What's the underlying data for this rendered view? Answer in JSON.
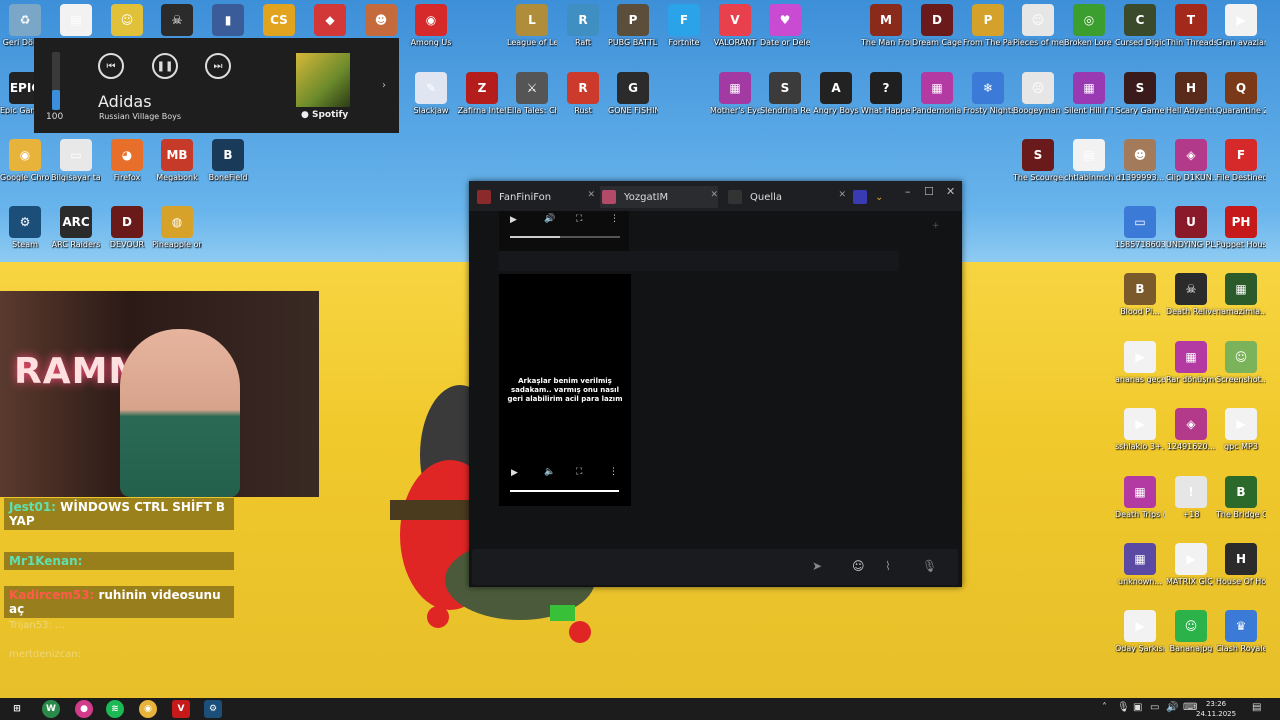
{
  "desktop": {
    "icons_top": [
      {
        "label": "Geri Dönüş",
        "glyph": "♻",
        "color": "#7aa7c7"
      },
      {
        "label": "",
        "glyph": "▤",
        "color": "#f2f2f2"
      },
      {
        "label": "",
        "glyph": "☺",
        "color": "#e2c13a"
      },
      {
        "label": "",
        "glyph": "☠",
        "color": "#2b2b2b"
      },
      {
        "label": "",
        "glyph": "▮",
        "color": "#3a5d9a"
      },
      {
        "label": "",
        "glyph": "CS",
        "color": "#e2a31f"
      },
      {
        "label": "",
        "glyph": "◆",
        "color": "#d23838"
      },
      {
        "label": "",
        "glyph": "☻",
        "color": "#c46a3c"
      },
      {
        "label": "Among Us",
        "glyph": "◉",
        "color": "#d62a2a"
      },
      {
        "label": "League of Legends",
        "glyph": "L",
        "color": "#b08d3a"
      },
      {
        "label": "Raft",
        "glyph": "R",
        "color": "#3f8fc3"
      },
      {
        "label": "PUBG BATTLEGR...",
        "glyph": "P",
        "color": "#5b4e3a"
      },
      {
        "label": "Fortnite",
        "glyph": "F",
        "color": "#2aa3e8"
      },
      {
        "label": "VALORANT",
        "glyph": "V",
        "color": "#e8404d"
      },
      {
        "label": "Date or Delete Ki...",
        "glyph": "♥",
        "color": "#c84bd1"
      },
      {
        "label": "The Man From Jonah",
        "glyph": "M",
        "color": "#8a2a1a"
      },
      {
        "label": "Dream Cage",
        "glyph": "D",
        "color": "#6a1a1a"
      },
      {
        "label": "From The Past",
        "glyph": "P",
        "color": "#d4a22a"
      },
      {
        "label": "Pieces of me",
        "glyph": "☺",
        "color": "#e6e6e6"
      },
      {
        "label": "Broken Lore DON'T W...",
        "glyph": "◎",
        "color": "#3c9e2f"
      },
      {
        "label": "Cursed Digicam 2...",
        "glyph": "C",
        "color": "#3b4a2a"
      },
      {
        "label": "Thin Threads",
        "glyph": "T",
        "color": "#a3291a"
      },
      {
        "label": "Gran avazlam MP3",
        "glyph": "▶",
        "color": "#f2f2f2"
      }
    ],
    "icons_row2": [
      {
        "label": "Epic Games Launcher",
        "glyph": "EPIC",
        "color": "#222"
      },
      {
        "label": "Slackjaw",
        "glyph": "✎",
        "color": "#dfe6f2"
      },
      {
        "label": "Zafirna Intel",
        "glyph": "Z",
        "color": "#b51d1d"
      },
      {
        "label": "Ella Tales: Chalkbound",
        "glyph": "⚔",
        "color": "#555"
      },
      {
        "label": "Rust",
        "glyph": "R",
        "color": "#cc3a2b"
      },
      {
        "label": "GONE FISHING",
        "glyph": "G",
        "color": "#2b2b2b"
      },
      {
        "label": "Mother's Eye DEMO.zip",
        "glyph": "▦",
        "color": "#a33aa3"
      },
      {
        "label": "Slendrina Remake",
        "glyph": "S",
        "color": "#3b3b3b"
      },
      {
        "label": "Angry Boys",
        "glyph": "A",
        "color": "#222"
      },
      {
        "label": "What Happened...",
        "glyph": "?",
        "color": "#1f1f1f"
      },
      {
        "label": "Pandemonia No BEKM - Ep...",
        "glyph": "▦",
        "color": "#b33aa3"
      },
      {
        "label": "Frosty Nights",
        "glyph": "❄",
        "color": "#3b7ad6"
      },
      {
        "label": "Boogeyman 2",
        "glyph": "☹",
        "color": "#e6e6e6"
      },
      {
        "label": "Silent Hill f Türkçe Yam...",
        "glyph": "▦",
        "color": "#9a3ab3"
      },
      {
        "label": "Scary Game",
        "glyph": "S",
        "color": "#3a1a1a"
      },
      {
        "label": "Hell Adventure",
        "glyph": "H",
        "color": "#5a2a1a"
      },
      {
        "label": "Quarantine Zone The...",
        "glyph": "Q",
        "color": "#7a3a1a"
      }
    ],
    "icons_row3": [
      {
        "label": "Google Chrome",
        "glyph": "◉",
        "color": "#e8b33a"
      },
      {
        "label": "Bilgisayar tarafından...",
        "glyph": "▭",
        "color": "#e8e8e8"
      },
      {
        "label": "Firefox",
        "glyph": "◕",
        "color": "#e86f2a"
      },
      {
        "label": "Megabonk",
        "glyph": "MB",
        "color": "#c63a2a"
      },
      {
        "label": "BoneField",
        "glyph": "B",
        "color": "#1a3a5a"
      }
    ],
    "icons_row4": [
      {
        "label": "Steam",
        "glyph": "⚙",
        "color": "#1b4f7a"
      },
      {
        "label": "ARC Raiders",
        "glyph": "ARC",
        "color": "#2b2b2b"
      },
      {
        "label": "DEVOUR",
        "glyph": "D",
        "color": "#6b1a1a"
      },
      {
        "label": "Pineapple on pizza",
        "glyph": "◍",
        "color": "#d6a22a"
      }
    ],
    "icons_right": [
      {
        "label": "The Scourge Lo Ölengin...",
        "glyph": "S",
        "color": "#6a1a1a"
      },
      {
        "label": "chtlabinmcht",
        "glyph": "▤",
        "color": "#f2f2f2"
      },
      {
        "label": "d1399993...",
        "glyph": "☻",
        "color": "#a37a5a"
      },
      {
        "label": "Clip D1KUN...",
        "glyph": "◈",
        "color": "#b33a8a"
      },
      {
        "label": "File Destined",
        "glyph": "F",
        "color": "#d62a2a"
      },
      {
        "label": "1585718603...",
        "glyph": "▭",
        "color": "#3b7ad6"
      },
      {
        "label": "UNDYING PLANS",
        "glyph": "U",
        "color": "#8a1a2a"
      },
      {
        "label": "Puppet House",
        "glyph": "PH",
        "color": "#c61a1a"
      },
      {
        "label": "Blood Pi...",
        "glyph": "B",
        "color": "#7a5a2a"
      },
      {
        "label": "Death Relives",
        "glyph": "☠",
        "color": "#2b2b2b"
      },
      {
        "label": "namazimla...",
        "glyph": "▦",
        "color": "#2b5a2b"
      },
      {
        "label": "ananas geçen 1...",
        "glyph": "▶",
        "color": "#f2f2f2"
      },
      {
        "label": "Rar dönüşmesi",
        "glyph": "▦",
        "color": "#b33aa3"
      },
      {
        "label": "Screenshot...",
        "glyph": "☺",
        "color": "#7ab35a"
      },
      {
        "label": "sshlakio 3+...",
        "glyph": "▶",
        "color": "#f2f2f2"
      },
      {
        "label": "12491620...",
        "glyph": "◈",
        "color": "#b33a8a"
      },
      {
        "label": "gpc MP3",
        "glyph": "▶",
        "color": "#f2f2f2"
      },
      {
        "label": "Death Trips (Windows)...",
        "glyph": "▦",
        "color": "#b33aa3"
      },
      {
        "label": "+18",
        "glyph": "!",
        "color": "#e6e6e6"
      },
      {
        "label": "The Bridge Curse 2 The...",
        "glyph": "B",
        "color": "#2b6a2b"
      },
      {
        "label": "unknown...",
        "glyph": "▦",
        "color": "#5a4aa3"
      },
      {
        "label": "MATRIX GİÇ KAARMUS...",
        "glyph": "▶",
        "color": "#f2f2f2"
      },
      {
        "label": "House Of Horror On...",
        "glyph": "H",
        "color": "#2b2b2b"
      },
      {
        "label": "Oday Şarkısı - gülay...",
        "glyph": "▶",
        "color": "#f2f2f2"
      },
      {
        "label": "Bananajpg",
        "glyph": "☺",
        "color": "#2bb34a"
      },
      {
        "label": "Clash Royale",
        "glyph": "♛",
        "color": "#3b7ad6"
      }
    ]
  },
  "media": {
    "volume_level": 100,
    "volume_text": "100",
    "title": "Adidas",
    "artist": "Russian Village Boys",
    "brand": "Spotify",
    "prev_icon": "previous-track-icon",
    "pause_icon": "pause-icon",
    "next_icon": "next-track-icon"
  },
  "webcam": {
    "sign_text": "RAMM"
  },
  "chat_overlay": {
    "messages": [
      {
        "nick": "Jest01:",
        "text": "WİNDOWS CTRL SHİFT B YAP"
      },
      {
        "nick": "Mr1Kenan:",
        "text": ""
      },
      {
        "nick": "Kadircem53:",
        "text": "ruhinin videosunu aç"
      }
    ],
    "faded": [
      "Trijan53: ...",
      "mertdenizcan:"
    ]
  },
  "chat_window": {
    "tabs": [
      {
        "label": "FanFiniFon",
        "color": "#8a2a2a"
      },
      {
        "label": "YozgatIM",
        "color": "#b34a6a"
      },
      {
        "label": "Quella",
        "color": "#333"
      }
    ],
    "video_caption": "Arkaşlar benim verilmiş sadakam.. varmış onu nasıl geri alabilirim acil para lazım",
    "video_progress_top": 0.45,
    "video_progress_bottom": 0.0
  },
  "taskbar": {
    "time": "23:26",
    "date": "24.11.2025"
  }
}
